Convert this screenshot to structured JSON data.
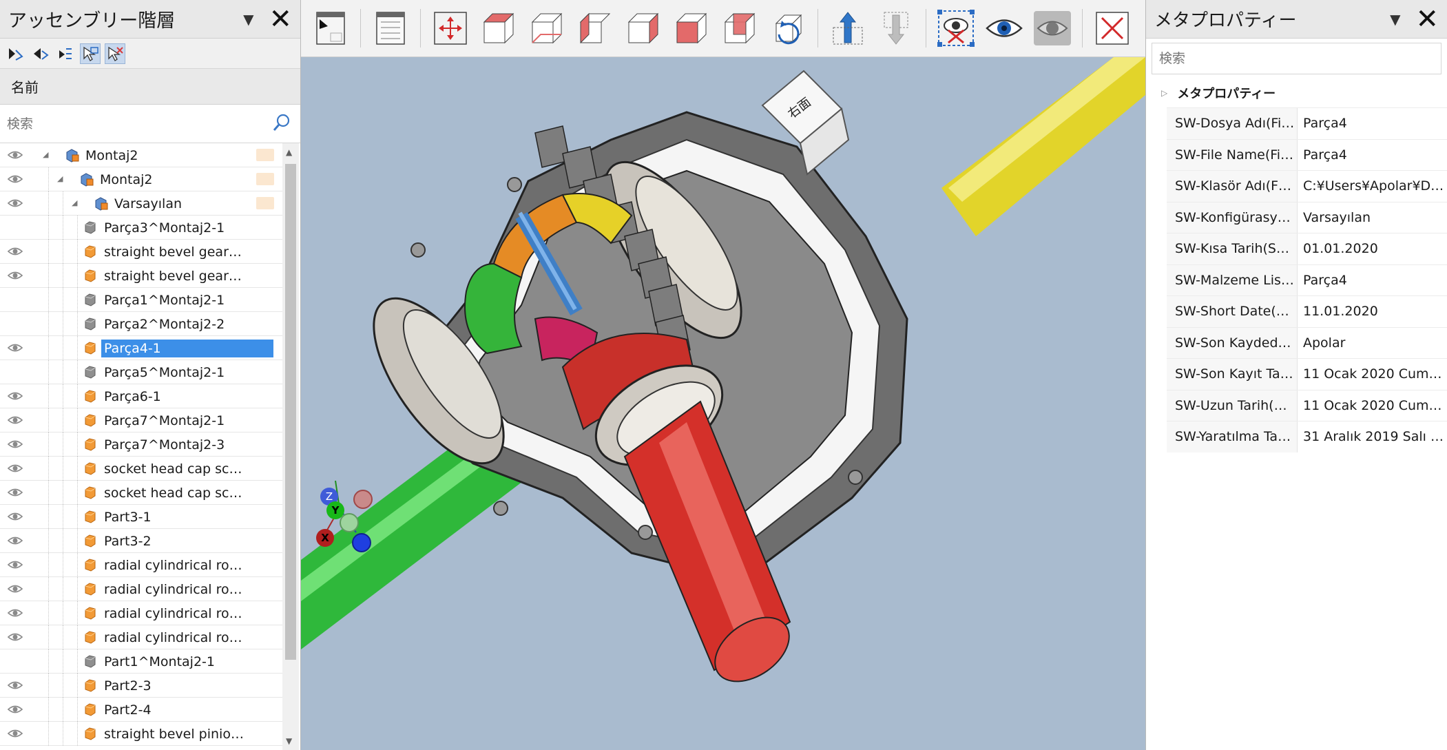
{
  "left_panel": {
    "title": "アッセンブリー階層",
    "column_header": "名前",
    "search_placeholder": "検索",
    "tree": [
      {
        "label": "Montaj2",
        "level": 0,
        "icon": "assembly-icon",
        "visible": true,
        "selected": false,
        "swatch": true
      },
      {
        "label": "Montaj2",
        "level": 1,
        "icon": "assembly-icon",
        "visible": true,
        "selected": false,
        "swatch": true
      },
      {
        "label": "Varsayılan",
        "level": 2,
        "icon": "assembly-icon",
        "visible": true,
        "selected": false,
        "swatch": true
      },
      {
        "label": "Parça3^Montaj2-1",
        "level": 3,
        "icon": "part-gray-icon",
        "visible": false,
        "selected": false
      },
      {
        "label": "straight bevel gear…",
        "level": 3,
        "icon": "part-orange-icon",
        "visible": true,
        "selected": false
      },
      {
        "label": "straight bevel gear…",
        "level": 3,
        "icon": "part-orange-icon",
        "visible": true,
        "selected": false
      },
      {
        "label": "Parça1^Montaj2-1",
        "level": 3,
        "icon": "part-gray-icon",
        "visible": false,
        "selected": false
      },
      {
        "label": "Parça2^Montaj2-2",
        "level": 3,
        "icon": "part-gray-icon",
        "visible": false,
        "selected": false
      },
      {
        "label": "Parça4-1",
        "level": 3,
        "icon": "part-orange-icon",
        "visible": true,
        "selected": true
      },
      {
        "label": "Parça5^Montaj2-1",
        "level": 3,
        "icon": "part-gray-icon",
        "visible": false,
        "selected": false
      },
      {
        "label": "Parça6-1",
        "level": 3,
        "icon": "part-orange-icon",
        "visible": true,
        "selected": false
      },
      {
        "label": "Parça7^Montaj2-1",
        "level": 3,
        "icon": "part-orange-icon",
        "visible": true,
        "selected": false
      },
      {
        "label": "Parça7^Montaj2-3",
        "level": 3,
        "icon": "part-orange-icon",
        "visible": true,
        "selected": false
      },
      {
        "label": "socket head cap sc…",
        "level": 3,
        "icon": "part-orange-icon",
        "visible": true,
        "selected": false
      },
      {
        "label": "socket head cap sc…",
        "level": 3,
        "icon": "part-orange-icon",
        "visible": true,
        "selected": false
      },
      {
        "label": "Part3-1",
        "level": 3,
        "icon": "part-orange-icon",
        "visible": true,
        "selected": false
      },
      {
        "label": "Part3-2",
        "level": 3,
        "icon": "part-orange-icon",
        "visible": true,
        "selected": false
      },
      {
        "label": "radial cylindrical ro…",
        "level": 3,
        "icon": "part-orange-icon",
        "visible": true,
        "selected": false
      },
      {
        "label": "radial cylindrical ro…",
        "level": 3,
        "icon": "part-orange-icon",
        "visible": true,
        "selected": false
      },
      {
        "label": "radial cylindrical ro…",
        "level": 3,
        "icon": "part-orange-icon",
        "visible": true,
        "selected": false
      },
      {
        "label": "radial cylindrical ro…",
        "level": 3,
        "icon": "part-orange-icon",
        "visible": true,
        "selected": false
      },
      {
        "label": "Part1^Montaj2-1",
        "level": 3,
        "icon": "part-gray-icon",
        "visible": false,
        "selected": false
      },
      {
        "label": "Part2-3",
        "level": 3,
        "icon": "part-orange-icon",
        "visible": true,
        "selected": false
      },
      {
        "label": "Part2-4",
        "level": 3,
        "icon": "part-orange-icon",
        "visible": true,
        "selected": false
      },
      {
        "label": "straight bevel pinio…",
        "level": 3,
        "icon": "part-orange-icon",
        "visible": true,
        "selected": false
      }
    ]
  },
  "toolbar": {
    "buttons": [
      "panel-toggle-icon",
      "document-icon",
      "fit-view-icon",
      "view-cube-front-icon",
      "view-cube-top-icon",
      "view-cube-left-icon",
      "view-cube-right-icon",
      "view-cube-bottom-icon",
      "view-cube-back-icon",
      "rotate-view-icon",
      "upload-arrow-icon",
      "download-arrow-icon",
      "hide-selected-icon",
      "show-icon",
      "show-all-icon",
      "close-model-icon"
    ]
  },
  "viewport": {
    "view_cube_label": "右面",
    "axis_labels": {
      "x": "X",
      "y": "Y",
      "z": "Z"
    },
    "colors": {
      "background": "#a9bbcf",
      "shaft_yellow": "#e2d42a",
      "shaft_green": "#2fb83b",
      "shaft_red": "#d4302a"
    }
  },
  "right_panel": {
    "title": "メタプロパティー",
    "search_placeholder": "検索",
    "group": "メタプロパティー",
    "properties": [
      {
        "key": "SW-Dosya Adı(Fi…",
        "value": "Parça4"
      },
      {
        "key": "SW-File Name(Fi…",
        "value": "Parça4"
      },
      {
        "key": "SW-Klasör Adı(F…",
        "value": "C:¥Users¥Apolar¥D…"
      },
      {
        "key": "SW-Konfigürasy…",
        "value": "Varsayılan"
      },
      {
        "key": "SW-Kısa Tarih(S…",
        "value": "01.01.2020"
      },
      {
        "key": "SW-Malzeme Lis…",
        "value": "Parça4"
      },
      {
        "key": "SW-Short Date(…",
        "value": "11.01.2020"
      },
      {
        "key": "SW-Son Kayded…",
        "value": "Apolar"
      },
      {
        "key": "SW-Son Kayıt Ta…",
        "value": "11 Ocak 2020 Cum…"
      },
      {
        "key": "SW-Uzun Tarih(…",
        "value": "11 Ocak 2020 Cum…"
      },
      {
        "key": "SW-Yaratılma Ta…",
        "value": "31 Aralık 2019 Salı …"
      }
    ]
  }
}
